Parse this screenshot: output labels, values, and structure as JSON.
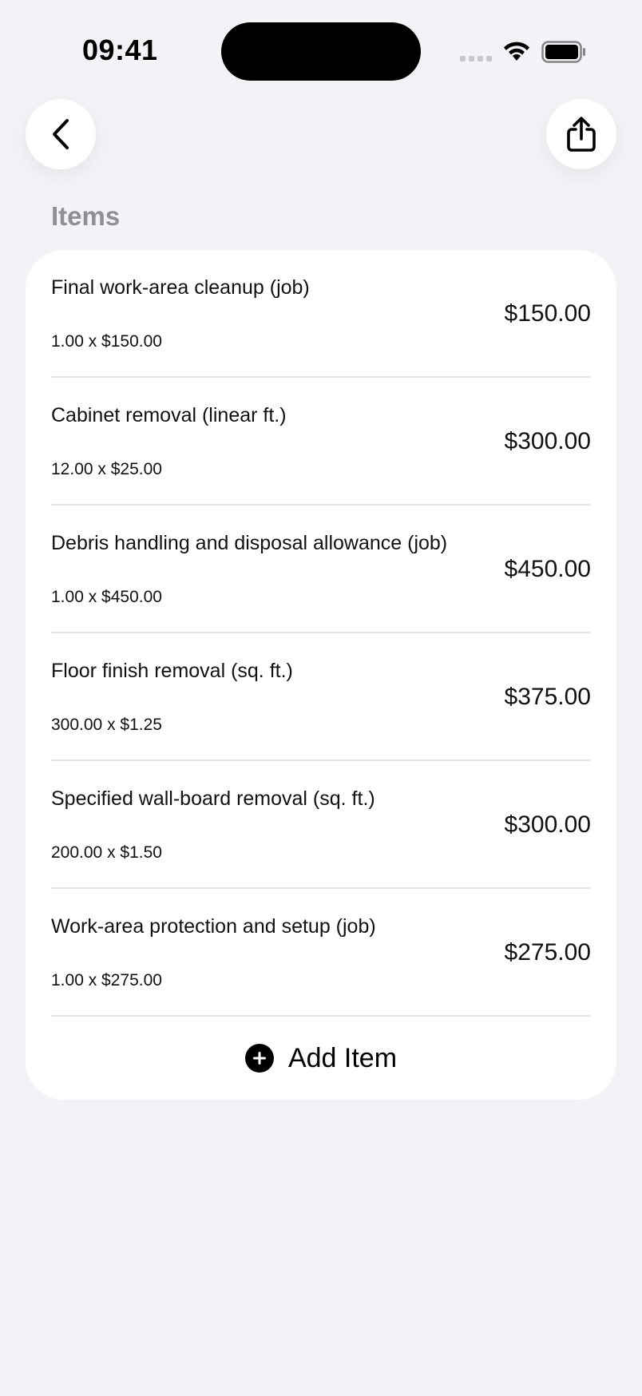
{
  "status_bar": {
    "time": "09:41"
  },
  "nav": {
    "back_icon": "chevron-left-icon",
    "share_icon": "share-icon"
  },
  "section": {
    "title": "Items"
  },
  "items": [
    {
      "name": "Final work-area cleanup (job)",
      "qty_price": "1.00 x $150.00",
      "total": "$150.00"
    },
    {
      "name": "Cabinet removal (linear ft.)",
      "qty_price": "12.00 x $25.00",
      "total": "$300.00"
    },
    {
      "name": "Debris handling and disposal allowance (job)",
      "qty_price": "1.00 x $450.00",
      "total": "$450.00"
    },
    {
      "name": "Floor finish removal (sq. ft.)",
      "qty_price": "300.00 x $1.25",
      "total": "$375.00"
    },
    {
      "name": "Specified wall-board removal (sq. ft.)",
      "qty_price": "200.00 x $1.50",
      "total": "$300.00"
    },
    {
      "name": "Work-area protection and setup (job)",
      "qty_price": "1.00 x $275.00",
      "total": "$275.00"
    }
  ],
  "add_item": {
    "label": "Add Item",
    "icon": "plus-circle-icon"
  },
  "colors": {
    "background": "#f2f2f7",
    "card": "#ffffff",
    "secondary_text": "#8e8e93",
    "separator": "#e5e5ea"
  }
}
